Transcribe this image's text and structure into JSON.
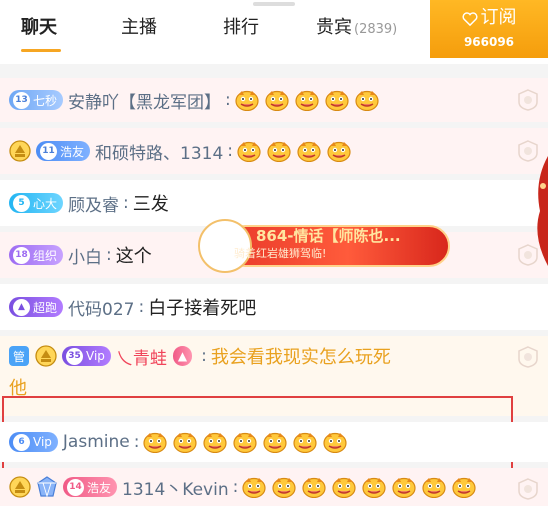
{
  "tabs": [
    {
      "label": "聊天",
      "active": true
    },
    {
      "label": "主播"
    },
    {
      "label": "排行"
    },
    {
      "label": "贵宾",
      "count": "(2839)"
    }
  ],
  "subscribe": {
    "label": "订阅",
    "count": "966096"
  },
  "rows": {
    "r1": {
      "badge": "七秒",
      "level": "13",
      "name": "安静吖【黑龙军团】",
      "emoji_count": 5
    },
    "r2": {
      "badge": "浩友",
      "level": "11",
      "name": "和硕特路、1314",
      "emoji_count": 4
    },
    "r3": {
      "badge": "心大",
      "level": "5",
      "name": "顾及睿",
      "message": "三发"
    },
    "r4": {
      "badge": "组织",
      "level": "18",
      "name": "小白",
      "message": "这个"
    },
    "r5": {
      "badge": "超跑",
      "name": "代码027",
      "message": "白子接着死吧"
    },
    "r6": {
      "admin": "管",
      "badge": "Vip",
      "level": "35",
      "name": "乀青蛙",
      "message_line1": "我会看我现实怎么玩死",
      "message_line2": "他"
    },
    "r7": {
      "badge": "Vip",
      "level": "6",
      "name": "Jasmine",
      "emoji_count": 7
    },
    "r8": {
      "badge": "浩友",
      "level": "14",
      "name": "1314丶Kevin",
      "emoji_count": 8
    }
  },
  "gift": {
    "title": "864-情话【师陈也...",
    "subtitle": "骑着红岩雄狮驾临!"
  },
  "colors": {
    "accent": "#f6a623",
    "name": "#5c6f86",
    "highlight": "#e04040",
    "gift": "#e93a2a"
  }
}
